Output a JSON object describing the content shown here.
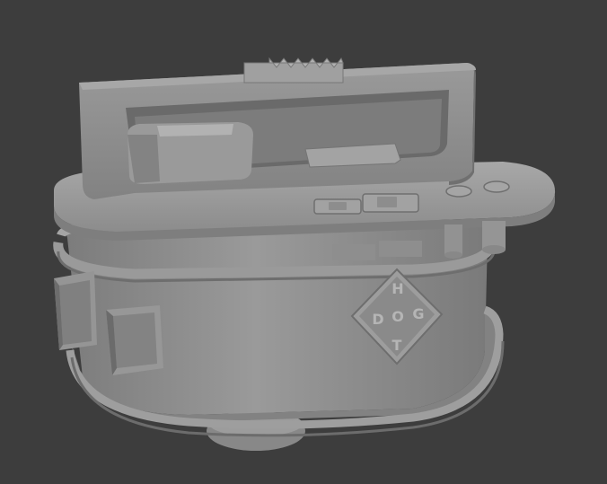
{
  "viewport": {
    "background": "#3d3d3d",
    "model_base_color": "#8e8e8e",
    "model_shadow_color": "#5a5a5a",
    "model_highlight_color": "#b4b4b4"
  },
  "logo": {
    "letters": [
      "H",
      "D",
      "O",
      "G",
      "T"
    ]
  }
}
